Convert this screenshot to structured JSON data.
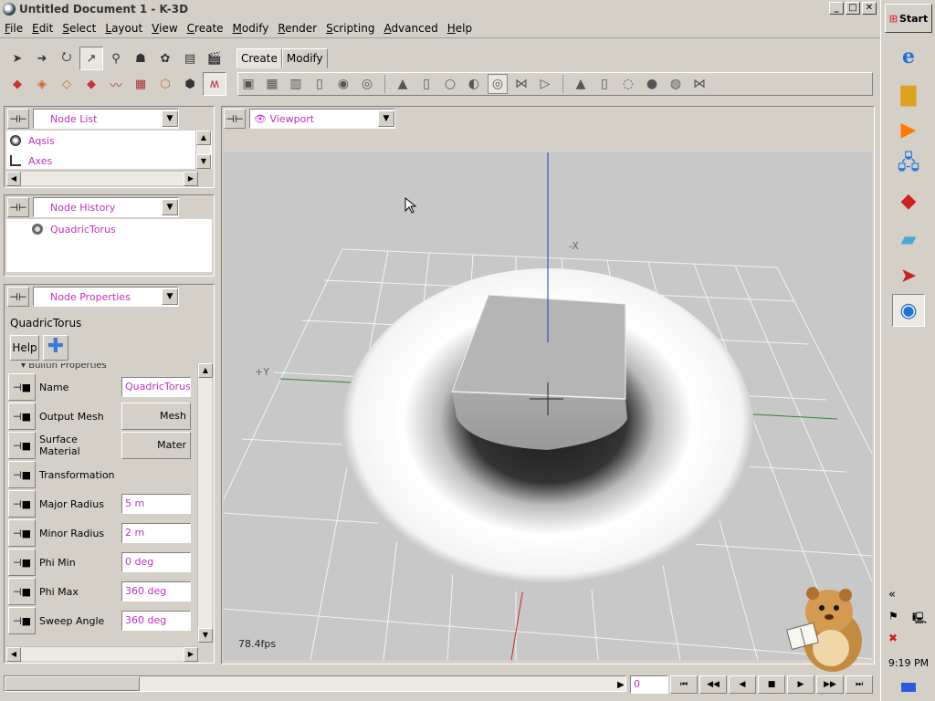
{
  "window": {
    "title": "Untitled Document 1 - K-3D",
    "min": "_",
    "max": "□",
    "close": "✕"
  },
  "menu": [
    {
      "label": "File",
      "u": "F",
      "rest": "ile"
    },
    {
      "label": "Edit",
      "u": "E",
      "rest": "dit"
    },
    {
      "label": "Select",
      "u": "S",
      "rest": "elect"
    },
    {
      "label": "Layout",
      "u": "L",
      "rest": "ayout"
    },
    {
      "label": "View",
      "u": "V",
      "rest": "iew"
    },
    {
      "label": "Create",
      "u": "C",
      "rest": "reate"
    },
    {
      "label": "Modify",
      "u": "M",
      "rest": "odify"
    },
    {
      "label": "Render",
      "u": "R",
      "rest": "ender"
    },
    {
      "label": "Scripting",
      "u": "S",
      "rest": "cripting"
    },
    {
      "label": "Advanced",
      "u": "A",
      "rest": "dvanced"
    },
    {
      "label": "Help",
      "u": "H",
      "rest": "elp"
    }
  ],
  "tabs": {
    "create": "Create",
    "modify": "Modify"
  },
  "node_list": {
    "title": "Node List",
    "items": [
      "Aqsis",
      "Axes"
    ]
  },
  "node_history": {
    "title": "Node History",
    "items": [
      "QuadricTorus"
    ]
  },
  "node_properties": {
    "title": "Node Properties",
    "node_name": "QuadricTorus",
    "help_label": "Help",
    "group": "Builtin Properties",
    "rows": [
      {
        "label": "Name",
        "value": "QuadricTorus",
        "kind": "input"
      },
      {
        "label": "Output Mesh",
        "value": "Mesh",
        "kind": "button"
      },
      {
        "label": "Surface Material",
        "value": "Mater",
        "kind": "button"
      },
      {
        "label": "Transformation",
        "value": "",
        "kind": "none"
      },
      {
        "label": "Major Radius",
        "value": "5 m",
        "kind": "input"
      },
      {
        "label": "Minor Radius",
        "value": "2 m",
        "kind": "input"
      },
      {
        "label": "Phi Min",
        "value": "0 deg",
        "kind": "input"
      },
      {
        "label": "Phi Max",
        "value": "360 deg",
        "kind": "input"
      },
      {
        "label": "Sweep Angle",
        "value": "360 deg",
        "kind": "input"
      }
    ]
  },
  "viewport": {
    "title": "Viewport",
    "fps": "78.4fps",
    "axis_neg_x": "-X",
    "axis_pos_y": "+Y"
  },
  "timeline": {
    "frame": "0"
  },
  "taskbar": {
    "start": "Start",
    "time": "9:19 PM",
    "expand": "«"
  }
}
